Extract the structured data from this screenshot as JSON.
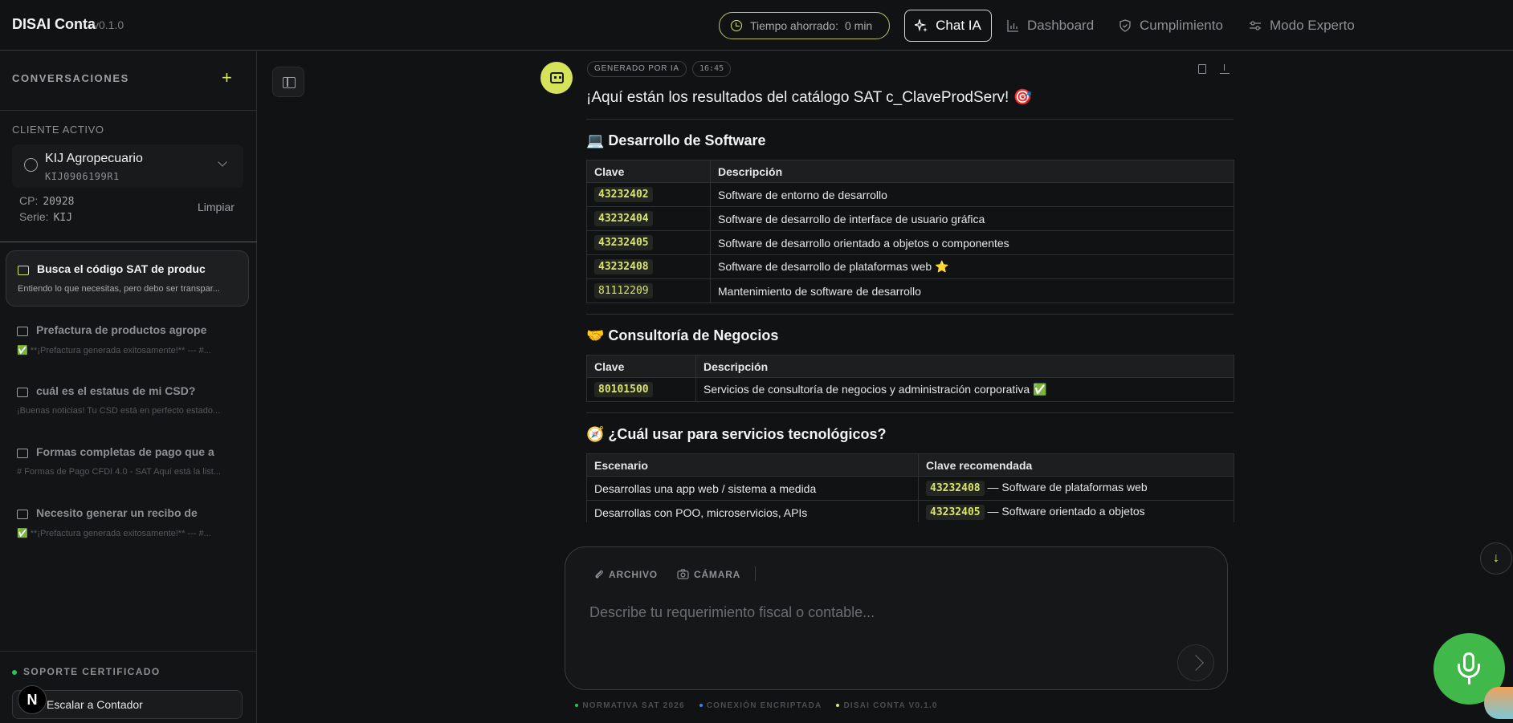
{
  "header": {
    "brand": "DISAI Conta",
    "version": "v0.1.0",
    "time_saved_label": "Tiempo ahorrado:",
    "time_saved_value": "0 min",
    "nav": [
      {
        "label": "Chat IA",
        "icon": "sparkles-icon",
        "active": true
      },
      {
        "label": "Dashboard",
        "icon": "bar-chart-icon",
        "active": false
      },
      {
        "label": "Cumplimiento",
        "icon": "shield-icon",
        "active": false
      },
      {
        "label": "Modo Experto",
        "icon": "sliders-icon",
        "active": false
      }
    ]
  },
  "sidebar": {
    "title": "CONVERSACIONES",
    "new_label": "+",
    "client_label": "CLIENTE ACTIVO",
    "client_name": "KIJ Agropecuario",
    "client_rfc": "KIJ0906199R1",
    "cp_label": "CP:",
    "cp_value": "20928",
    "serie_label": "Serie:",
    "serie_value": "KIJ",
    "clear_label": "Limpiar",
    "conversations": [
      {
        "title": "Busca el código SAT de produc",
        "snippet": "Entiendo lo que necesitas, pero debo ser transpar...",
        "active": true
      },
      {
        "title": "Prefactura de productos agrope",
        "snippet": "✅ **¡Prefactura generada exitosamente!** --- #...",
        "active": false
      },
      {
        "title": "cuál es el estatus de mi CSD?",
        "snippet": "¡Buenas noticias! Tu CSD está en perfecto estado...",
        "active": false
      },
      {
        "title": "Formas completas de pago que a",
        "snippet": "# Formas de Pago CFDI 4.0 - SAT Aquí está la list...",
        "active": false
      },
      {
        "title": "Necesito generar un recibo de",
        "snippet": "✅ **¡Prefactura generada exitosamente!** --- #...",
        "active": false
      }
    ],
    "support_label": "SOPORTE CERTIFICADO",
    "escalate_label": "Escalar a Contador",
    "n_badge": "N"
  },
  "message": {
    "badge": "GENERADO POR IA",
    "time": "16:45",
    "title": "¡Aquí están los resultados del catálogo SAT c_ClaveProdServ! 🎯",
    "section1": {
      "heading": "💻 Desarrollo de Software",
      "headers": [
        "Clave",
        "Descripción"
      ],
      "rows": [
        {
          "code": "43232402",
          "desc": "Software de entorno de desarrollo"
        },
        {
          "code": "43232404",
          "desc": "Software de desarrollo de interface de usuario gráfica"
        },
        {
          "code": "43232405",
          "desc": "Software de desarrollo orientado a objetos o componentes"
        },
        {
          "code": "43232408",
          "desc": "Software de desarrollo de plataformas web ⭐"
        },
        {
          "code": "81112209",
          "desc": "Mantenimiento de software de desarrollo"
        }
      ]
    },
    "section2": {
      "heading": "🤝 Consultoría de Negocios",
      "headers": [
        "Clave",
        "Descripción"
      ],
      "rows": [
        {
          "code": "80101500",
          "desc": "Servicios de consultoría de negocios y administración corporativa ✅"
        }
      ]
    },
    "section3": {
      "heading": "🧭 ¿Cuál usar para servicios tecnológicos?",
      "headers": [
        "Escenario",
        "Clave recomendada"
      ],
      "rows": [
        {
          "scenario": "Desarrollas una app web / sistema a medida",
          "code": "43232408",
          "note": "— Software de plataformas web"
        },
        {
          "scenario": "Desarrollas con POO, microservicios, APIs",
          "code": "43232405",
          "note": "— Software orientado a objetos"
        }
      ]
    }
  },
  "composer": {
    "file_label": "ARCHIVO",
    "camera_label": "CÁMARA",
    "placeholder": "Describe tu requerimiento fiscal o contable..."
  },
  "footer": {
    "items": [
      {
        "label": "NORMATIVA SAT 2026",
        "dot_color": "#22c55e"
      },
      {
        "label": "CONEXIÓN ENCRIPTADA",
        "dot_color": "#3b82f6"
      },
      {
        "label": "DISAI CONTA V0.1.0",
        "dot_color": "#d9e46a"
      }
    ]
  },
  "colors": {
    "accent": "#d9e46a",
    "mic_green": "#41b84a"
  }
}
